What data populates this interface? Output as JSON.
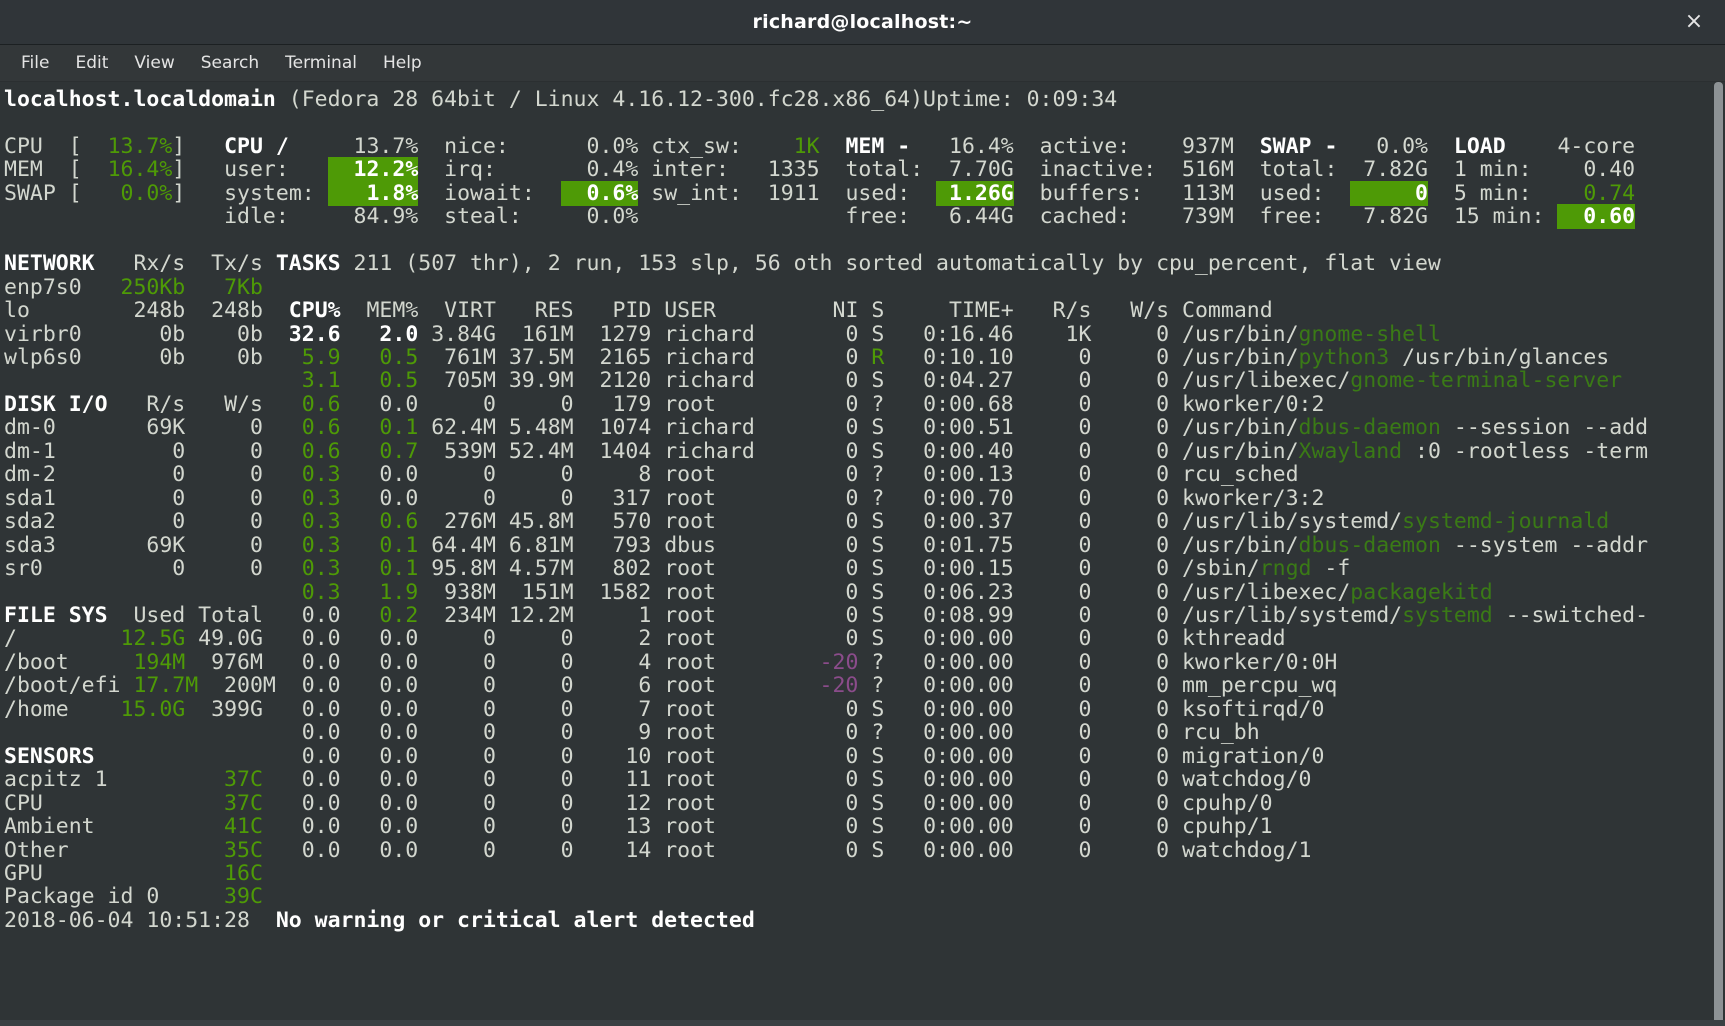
{
  "window": {
    "title": "richard@localhost:~",
    "close_label": "×"
  },
  "menubar": {
    "items": [
      {
        "label": "File"
      },
      {
        "label": "Edit"
      },
      {
        "label": "View"
      },
      {
        "label": "Search"
      },
      {
        "label": "Terminal"
      },
      {
        "label": "Help"
      }
    ]
  },
  "header": {
    "hostname": "localhost.localdomain",
    "system": "(Fedora 28 64bit / Linux 4.16.12-300.fc28.x86_64)",
    "uptime_label": "Uptime:",
    "uptime_value": "0:09:34"
  },
  "quicklook": {
    "rows": [
      {
        "label": "CPU",
        "bracket_open": "[",
        "value": "13.7%",
        "bracket_close": "]"
      },
      {
        "label": "MEM",
        "bracket_open": "[",
        "value": "16.4%",
        "bracket_close": "]"
      },
      {
        "label": "SWAP",
        "bracket_open": "[",
        "value": "0.0%",
        "bracket_close": "]"
      }
    ]
  },
  "cpu": {
    "title": "CPU",
    "title_suffix": "/",
    "total": "13.7%",
    "rows": [
      {
        "label": "user:",
        "value": "12.2%",
        "highlight": true
      },
      {
        "label": "system:",
        "value": "1.8%",
        "highlight": true
      },
      {
        "label": "idle:",
        "value": "84.9%",
        "highlight": false
      }
    ],
    "rows2": [
      {
        "label": "nice:",
        "value": "0.0%",
        "highlight": false
      },
      {
        "label": "irq:",
        "value": "0.4%",
        "highlight": false
      },
      {
        "label": "iowait:",
        "value": "0.6%",
        "highlight": true
      },
      {
        "label": "steal:",
        "value": "0.0%",
        "highlight": false
      }
    ],
    "rows3": [
      {
        "label": "ctx_sw:",
        "value": "1K"
      },
      {
        "label": "inter:",
        "value": "1335"
      },
      {
        "label": "sw_int:",
        "value": "1911"
      }
    ]
  },
  "mem": {
    "title": "MEM",
    "title_suffix": "-",
    "percent": "16.4%",
    "rows": [
      {
        "label": "total:",
        "value": "7.70G",
        "highlight": false
      },
      {
        "label": "used:",
        "value": "1.26G",
        "highlight": true
      },
      {
        "label": "free:",
        "value": "6.44G",
        "highlight": false
      }
    ],
    "rows2": [
      {
        "label": "active:",
        "value": "937M"
      },
      {
        "label": "inactive:",
        "value": "516M"
      },
      {
        "label": "buffers:",
        "value": "113M"
      },
      {
        "label": "cached:",
        "value": "739M"
      }
    ]
  },
  "swap": {
    "title": "SWAP",
    "title_suffix": "-",
    "percent": "0.0%",
    "rows": [
      {
        "label": "total:",
        "value": "7.82G",
        "highlight": false
      },
      {
        "label": "used:",
        "value": "0",
        "highlight": true
      },
      {
        "label": "free:",
        "value": "7.82G",
        "highlight": false
      }
    ]
  },
  "load": {
    "title": "LOAD",
    "cores": "4-core",
    "rows": [
      {
        "label": "1 min:",
        "value": "0.40",
        "color": "white",
        "highlight": false
      },
      {
        "label": "5 min:",
        "value": "0.74",
        "color": "green",
        "highlight": false
      },
      {
        "label": "15 min:",
        "value": "0.60",
        "color": "white",
        "highlight": true
      }
    ]
  },
  "network": {
    "title": "NETWORK",
    "col_rx": "Rx/s",
    "col_tx": "Tx/s",
    "rows": [
      {
        "name": "enp7s0",
        "rx": "250Kb",
        "tx": "7Kb",
        "active": true
      },
      {
        "name": "lo",
        "rx": "248b",
        "tx": "248b",
        "active": false
      },
      {
        "name": "virbr0",
        "rx": "0b",
        "tx": "0b",
        "active": false
      },
      {
        "name": "wlp6s0",
        "rx": "0b",
        "tx": "0b",
        "active": false
      }
    ]
  },
  "diskio": {
    "title": "DISK I/O",
    "col_r": "R/s",
    "col_w": "W/s",
    "rows": [
      {
        "name": "dm-0",
        "r": "69K",
        "w": "0"
      },
      {
        "name": "dm-1",
        "r": "0",
        "w": "0"
      },
      {
        "name": "dm-2",
        "r": "0",
        "w": "0"
      },
      {
        "name": "sda1",
        "r": "0",
        "w": "0"
      },
      {
        "name": "sda2",
        "r": "0",
        "w": "0"
      },
      {
        "name": "sda3",
        "r": "69K",
        "w": "0"
      },
      {
        "name": "sr0",
        "r": "0",
        "w": "0"
      }
    ]
  },
  "filesys": {
    "title": "FILE SYS",
    "col_used": "Used",
    "col_total": "Total",
    "rows": [
      {
        "mount": "/",
        "used": "12.5G",
        "total": "49.0G"
      },
      {
        "mount": "/boot",
        "used": "194M",
        "total": "976M"
      },
      {
        "mount": "/boot/efi",
        "used": "17.7M",
        "total": "200M"
      },
      {
        "mount": "/home",
        "used": "15.0G",
        "total": "399G"
      }
    ]
  },
  "sensors": {
    "title": "SENSORS",
    "rows": [
      {
        "name": "acpitz 1",
        "value": "37C"
      },
      {
        "name": "CPU",
        "value": "37C"
      },
      {
        "name": "Ambient",
        "value": "41C"
      },
      {
        "name": "Other",
        "value": "35C"
      },
      {
        "name": "GPU",
        "value": "16C"
      },
      {
        "name": "Package id 0",
        "value": "39C"
      }
    ]
  },
  "tasks": {
    "title": "TASKS",
    "summary": "211 (507 thr), 2 run, 153 slp, 56 oth sorted automatically by cpu_percent, flat view"
  },
  "process_table": {
    "headers": {
      "cpu": "CPU%",
      "mem": "MEM%",
      "virt": "VIRT",
      "res": "RES",
      "pid": "PID",
      "user": "USER",
      "ni": "NI",
      "s": "S",
      "time": "TIME+",
      "rs": "R/s",
      "ws": "W/s",
      "command": "Command"
    },
    "rows": [
      {
        "cpu": "32.6",
        "cpu_style": "hdr",
        "mem": "2.0",
        "mem_style": "hdr",
        "virt": "3.84G",
        "res": "161M",
        "pid": "1279",
        "user": "richard",
        "ni": "0",
        "ni_style": "white",
        "s": "S",
        "s_style": "white",
        "time": "0:16.46",
        "rs": "1K",
        "ws": "0",
        "cmd_prefix": "/usr/bin/",
        "cmd_name": "gnome-shell",
        "cmd_suffix": ""
      },
      {
        "cpu": "5.9",
        "cpu_style": "green",
        "mem": "0.5",
        "mem_style": "green",
        "virt": "761M",
        "res": "37.5M",
        "pid": "2165",
        "user": "richard",
        "ni": "0",
        "ni_style": "white",
        "s": "R",
        "s_style": "green",
        "time": "0:10.10",
        "rs": "0",
        "ws": "0",
        "cmd_prefix": "/usr/bin/",
        "cmd_name": "python3",
        "cmd_suffix": " /usr/bin/glances"
      },
      {
        "cpu": "3.1",
        "cpu_style": "green",
        "mem": "0.5",
        "mem_style": "green",
        "virt": "705M",
        "res": "39.9M",
        "pid": "2120",
        "user": "richard",
        "ni": "0",
        "ni_style": "white",
        "s": "S",
        "s_style": "white",
        "time": "0:04.27",
        "rs": "0",
        "ws": "0",
        "cmd_prefix": "/usr/libexec/",
        "cmd_name": "gnome-terminal-server",
        "cmd_suffix": ""
      },
      {
        "cpu": "0.6",
        "cpu_style": "green",
        "mem": "0.0",
        "mem_style": "white",
        "virt": "0",
        "res": "0",
        "pid": "179",
        "user": "root",
        "ni": "0",
        "ni_style": "white",
        "s": "?",
        "s_style": "white",
        "time": "0:00.68",
        "rs": "0",
        "ws": "0",
        "cmd_prefix": "kworker/0:2",
        "cmd_name": "",
        "cmd_suffix": ""
      },
      {
        "cpu": "0.6",
        "cpu_style": "green",
        "mem": "0.1",
        "mem_style": "green",
        "virt": "62.4M",
        "res": "5.48M",
        "pid": "1074",
        "user": "richard",
        "ni": "0",
        "ni_style": "white",
        "s": "S",
        "s_style": "white",
        "time": "0:00.51",
        "rs": "0",
        "ws": "0",
        "cmd_prefix": "/usr/bin/",
        "cmd_name": "dbus-daemon",
        "cmd_suffix": " --session --add"
      },
      {
        "cpu": "0.6",
        "cpu_style": "green",
        "mem": "0.7",
        "mem_style": "green",
        "virt": "539M",
        "res": "52.4M",
        "pid": "1404",
        "user": "richard",
        "ni": "0",
        "ni_style": "white",
        "s": "S",
        "s_style": "white",
        "time": "0:00.40",
        "rs": "0",
        "ws": "0",
        "cmd_prefix": "/usr/bin/",
        "cmd_name": "Xwayland",
        "cmd_suffix": " :0 -rootless -term"
      },
      {
        "cpu": "0.3",
        "cpu_style": "green",
        "mem": "0.0",
        "mem_style": "white",
        "virt": "0",
        "res": "0",
        "pid": "8",
        "user": "root",
        "ni": "0",
        "ni_style": "white",
        "s": "?",
        "s_style": "white",
        "time": "0:00.13",
        "rs": "0",
        "ws": "0",
        "cmd_prefix": "rcu_sched",
        "cmd_name": "",
        "cmd_suffix": ""
      },
      {
        "cpu": "0.3",
        "cpu_style": "green",
        "mem": "0.0",
        "mem_style": "white",
        "virt": "0",
        "res": "0",
        "pid": "317",
        "user": "root",
        "ni": "0",
        "ni_style": "white",
        "s": "?",
        "s_style": "white",
        "time": "0:00.70",
        "rs": "0",
        "ws": "0",
        "cmd_prefix": "kworker/3:2",
        "cmd_name": "",
        "cmd_suffix": ""
      },
      {
        "cpu": "0.3",
        "cpu_style": "green",
        "mem": "0.6",
        "mem_style": "green",
        "virt": "276M",
        "res": "45.8M",
        "pid": "570",
        "user": "root",
        "ni": "0",
        "ni_style": "white",
        "s": "S",
        "s_style": "white",
        "time": "0:00.37",
        "rs": "0",
        "ws": "0",
        "cmd_prefix": "/usr/lib/systemd/",
        "cmd_name": "systemd-journald",
        "cmd_suffix": ""
      },
      {
        "cpu": "0.3",
        "cpu_style": "green",
        "mem": "0.1",
        "mem_style": "green",
        "virt": "64.4M",
        "res": "6.81M",
        "pid": "793",
        "user": "dbus",
        "ni": "0",
        "ni_style": "white",
        "s": "S",
        "s_style": "white",
        "time": "0:01.75",
        "rs": "0",
        "ws": "0",
        "cmd_prefix": "/usr/bin/",
        "cmd_name": "dbus-daemon",
        "cmd_suffix": " --system --addr"
      },
      {
        "cpu": "0.3",
        "cpu_style": "green",
        "mem": "0.1",
        "mem_style": "green",
        "virt": "95.8M",
        "res": "4.57M",
        "pid": "802",
        "user": "root",
        "ni": "0",
        "ni_style": "white",
        "s": "S",
        "s_style": "white",
        "time": "0:00.15",
        "rs": "0",
        "ws": "0",
        "cmd_prefix": "/sbin/",
        "cmd_name": "rngd",
        "cmd_suffix": " -f"
      },
      {
        "cpu": "0.3",
        "cpu_style": "green",
        "mem": "1.9",
        "mem_style": "green",
        "virt": "938M",
        "res": "151M",
        "pid": "1582",
        "user": "root",
        "ni": "0",
        "ni_style": "white",
        "s": "S",
        "s_style": "white",
        "time": "0:06.23",
        "rs": "0",
        "ws": "0",
        "cmd_prefix": "/usr/libexec/",
        "cmd_name": "packagekitd",
        "cmd_suffix": ""
      },
      {
        "cpu": "0.0",
        "cpu_style": "white",
        "mem": "0.2",
        "mem_style": "green",
        "virt": "234M",
        "res": "12.2M",
        "pid": "1",
        "user": "root",
        "ni": "0",
        "ni_style": "white",
        "s": "S",
        "s_style": "white",
        "time": "0:08.99",
        "rs": "0",
        "ws": "0",
        "cmd_prefix": "/usr/lib/systemd/",
        "cmd_name": "systemd",
        "cmd_suffix": " --switched-"
      },
      {
        "cpu": "0.0",
        "cpu_style": "white",
        "mem": "0.0",
        "mem_style": "white",
        "virt": "0",
        "res": "0",
        "pid": "2",
        "user": "root",
        "ni": "0",
        "ni_style": "white",
        "s": "S",
        "s_style": "white",
        "time": "0:00.00",
        "rs": "0",
        "ws": "0",
        "cmd_prefix": "kthreadd",
        "cmd_name": "",
        "cmd_suffix": ""
      },
      {
        "cpu": "0.0",
        "cpu_style": "white",
        "mem": "0.0",
        "mem_style": "white",
        "virt": "0",
        "res": "0",
        "pid": "4",
        "user": "root",
        "ni": "-20",
        "ni_style": "magenta",
        "s": "?",
        "s_style": "white",
        "time": "0:00.00",
        "rs": "0",
        "ws": "0",
        "cmd_prefix": "kworker/0:0H",
        "cmd_name": "",
        "cmd_suffix": ""
      },
      {
        "cpu": "0.0",
        "cpu_style": "white",
        "mem": "0.0",
        "mem_style": "white",
        "virt": "0",
        "res": "0",
        "pid": "6",
        "user": "root",
        "ni": "-20",
        "ni_style": "magenta",
        "s": "?",
        "s_style": "white",
        "time": "0:00.00",
        "rs": "0",
        "ws": "0",
        "cmd_prefix": "mm_percpu_wq",
        "cmd_name": "",
        "cmd_suffix": ""
      },
      {
        "cpu": "0.0",
        "cpu_style": "white",
        "mem": "0.0",
        "mem_style": "white",
        "virt": "0",
        "res": "0",
        "pid": "7",
        "user": "root",
        "ni": "0",
        "ni_style": "white",
        "s": "S",
        "s_style": "white",
        "time": "0:00.00",
        "rs": "0",
        "ws": "0",
        "cmd_prefix": "ksoftirqd/0",
        "cmd_name": "",
        "cmd_suffix": ""
      },
      {
        "cpu": "0.0",
        "cpu_style": "white",
        "mem": "0.0",
        "mem_style": "white",
        "virt": "0",
        "res": "0",
        "pid": "9",
        "user": "root",
        "ni": "0",
        "ni_style": "white",
        "s": "?",
        "s_style": "white",
        "time": "0:00.00",
        "rs": "0",
        "ws": "0",
        "cmd_prefix": "rcu_bh",
        "cmd_name": "",
        "cmd_suffix": ""
      },
      {
        "cpu": "0.0",
        "cpu_style": "white",
        "mem": "0.0",
        "mem_style": "white",
        "virt": "0",
        "res": "0",
        "pid": "10",
        "user": "root",
        "ni": "0",
        "ni_style": "white",
        "s": "S",
        "s_style": "white",
        "time": "0:00.00",
        "rs": "0",
        "ws": "0",
        "cmd_prefix": "migration/0",
        "cmd_name": "",
        "cmd_suffix": ""
      },
      {
        "cpu": "0.0",
        "cpu_style": "white",
        "mem": "0.0",
        "mem_style": "white",
        "virt": "0",
        "res": "0",
        "pid": "11",
        "user": "root",
        "ni": "0",
        "ni_style": "white",
        "s": "S",
        "s_style": "white",
        "time": "0:00.00",
        "rs": "0",
        "ws": "0",
        "cmd_prefix": "watchdog/0",
        "cmd_name": "",
        "cmd_suffix": ""
      },
      {
        "cpu": "0.0",
        "cpu_style": "white",
        "mem": "0.0",
        "mem_style": "white",
        "virt": "0",
        "res": "0",
        "pid": "12",
        "user": "root",
        "ni": "0",
        "ni_style": "white",
        "s": "S",
        "s_style": "white",
        "time": "0:00.00",
        "rs": "0",
        "ws": "0",
        "cmd_prefix": "cpuhp/0",
        "cmd_name": "",
        "cmd_suffix": ""
      },
      {
        "cpu": "0.0",
        "cpu_style": "white",
        "mem": "0.0",
        "mem_style": "white",
        "virt": "0",
        "res": "0",
        "pid": "13",
        "user": "root",
        "ni": "0",
        "ni_style": "white",
        "s": "S",
        "s_style": "white",
        "time": "0:00.00",
        "rs": "0",
        "ws": "0",
        "cmd_prefix": "cpuhp/1",
        "cmd_name": "",
        "cmd_suffix": ""
      },
      {
        "cpu": "0.0",
        "cpu_style": "white",
        "mem": "0.0",
        "mem_style": "white",
        "virt": "0",
        "res": "0",
        "pid": "14",
        "user": "root",
        "ni": "0",
        "ni_style": "white",
        "s": "S",
        "s_style": "white",
        "time": "0:00.00",
        "rs": "0",
        "ws": "0",
        "cmd_prefix": "watchdog/1",
        "cmd_name": "",
        "cmd_suffix": ""
      }
    ]
  },
  "statusbar": {
    "timestamp": "2018-06-04 10:51:28",
    "message": "No warning or critical alert detected"
  },
  "colors": {
    "background": "#2f3436",
    "foreground": "#d3d7cf",
    "accent_green": "#4e9a06",
    "highlight_bg": "#4e9a06",
    "magenta": "#8b4c8b",
    "titlebar": "#303539"
  }
}
